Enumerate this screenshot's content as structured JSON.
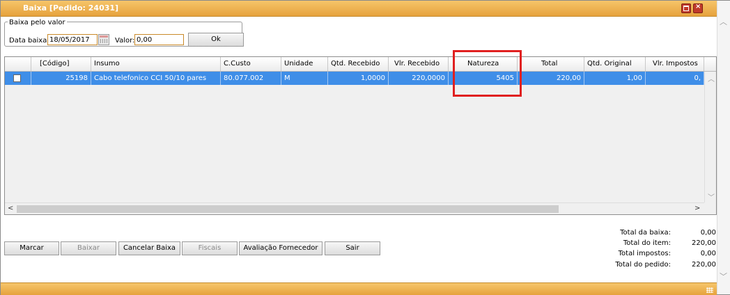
{
  "window": {
    "title": "Baixa [Pedido: 24031]"
  },
  "baixa_group": {
    "legend": "Baixa pelo valor",
    "date_label": "Data baixa:",
    "date_value": "18/05/2017",
    "valor_label": "Valor:",
    "valor_value": "0,00",
    "ok_label": "Ok"
  },
  "grid": {
    "columns": [
      "[Código]",
      "Insumo",
      "C.Custo",
      "Unidade",
      "Qtd. Recebido",
      "Vlr. Recebido",
      "Natureza",
      "Total",
      "Qtd. Original",
      "Vlr. Impostos"
    ],
    "rows": [
      {
        "codigo": "25198",
        "insumo": "Cabo telefonico CCI 50/10 pares",
        "ccusto": "80.077.002",
        "unidade": "M",
        "qtd_recebido": "1,0000",
        "vlr_recebido": "220,0000",
        "natureza": "5405",
        "total": "220,00",
        "qtd_original": "1,00",
        "vlr_impostos": "0,"
      }
    ]
  },
  "buttons": {
    "marcar": "Marcar",
    "baixar": "Baixar",
    "cancelar": "Cancelar Baixa",
    "fiscais": "Fiscais",
    "avaliacao": "Avaliação Fornecedor",
    "sair": "Sair"
  },
  "totals": [
    {
      "label": "Total da baixa:",
      "value": "0,00"
    },
    {
      "label": "Total do item:",
      "value": "220,00"
    },
    {
      "label": "Total impostos:",
      "value": "0,00"
    },
    {
      "label": "Total do pedido:",
      "value": "220,00"
    }
  ],
  "icons": {
    "maximize": "maximize-icon",
    "close": "close-icon",
    "calendar": "calendar-icon"
  },
  "colors": {
    "title_bar": "#e6a23c",
    "selection": "#3f8ee8",
    "highlight_box": "#e02020"
  }
}
